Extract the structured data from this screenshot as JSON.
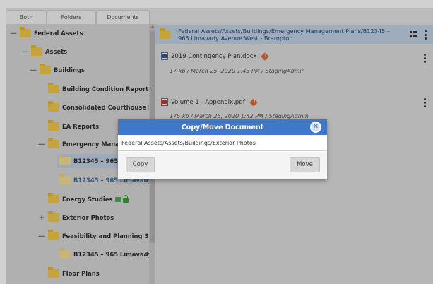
{
  "tabs": [
    "Both",
    "Folders",
    "Documents"
  ],
  "tree": {
    "nodes": [
      {
        "label": "Federal Assets",
        "toggle": "—"
      },
      {
        "label": "Assets",
        "toggle": "—"
      },
      {
        "label": "Buildings",
        "toggle": "—"
      },
      {
        "label": "Building Condition Report",
        "toggle": ""
      },
      {
        "label": "Consolidated Courthouse S...",
        "toggle": ""
      },
      {
        "label": "EA Reports",
        "toggle": ""
      },
      {
        "label": "Emergency Managem",
        "toggle": "—"
      },
      {
        "label": "B12345 – 965 Lima",
        "toggle": ""
      },
      {
        "label": "B12345 – 965 Limavady ...",
        "toggle": ""
      },
      {
        "label": "Energy Studies",
        "toggle": ""
      },
      {
        "label": "Exterior Photos",
        "toggle": "+"
      },
      {
        "label": "Feasibility and Planning Stu...",
        "toggle": "—"
      },
      {
        "label": "B12345 – 965 Limavady ...",
        "toggle": ""
      },
      {
        "label": "Floor Plans",
        "toggle": ""
      }
    ]
  },
  "path_bar": {
    "text": "Federal Assets/Assets/Buildings/Emergency Management Plans/B12345 – 965 Limavady Avenue West - Brampton"
  },
  "documents": [
    {
      "name": "2019 Contingency Plan.docx",
      "meta": "17 kb / March 25, 2020 1:43 PM / StagingAdmin"
    },
    {
      "name": "Volume 1 - Appendix.pdf",
      "meta": "175 kb / March 25, 2020 1:42 PM / StagingAdmin"
    }
  ],
  "modal": {
    "title": "Copy/Move Document",
    "close_glyph": "✕",
    "path": "Federal Assets/Assets/Buildings/Exterior Photos",
    "copy_label": "Copy",
    "move_label": "Move"
  },
  "colors": {
    "modal_header": "#3f77c9",
    "path_bar": "#c3d2e4",
    "folder": "#f2c84b"
  }
}
